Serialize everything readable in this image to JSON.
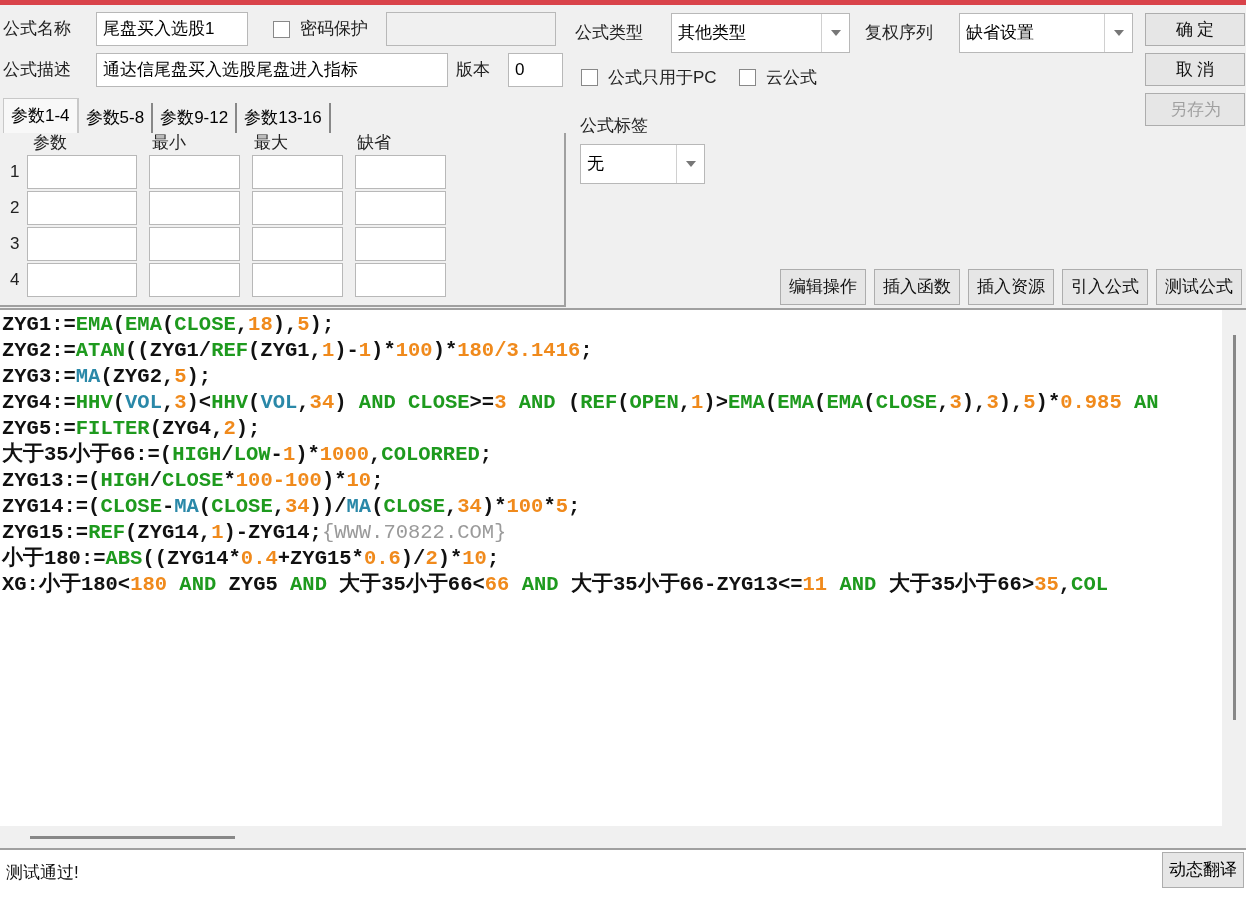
{
  "form": {
    "name_label": "公式名称",
    "name_value": "尾盘买入选股1",
    "password": {
      "label": "密码保护",
      "checked": false
    },
    "desc_label": "公式描述",
    "desc_value": "通达信尾盘买入选股尾盘进入指标",
    "version_label": "版本",
    "version_value": "0",
    "type_label": "公式类型",
    "type_value": "其他类型",
    "rights_label": "复权序列",
    "rights_value": "缺省设置",
    "options": [
      {
        "label": "公式只用于PC",
        "checked": false
      },
      {
        "label": "云公式",
        "checked": false
      }
    ],
    "tag_label": "公式标签",
    "tag_value": "无"
  },
  "dialog_buttons": [
    {
      "label": "确 定",
      "disabled": false
    },
    {
      "label": "取 消",
      "disabled": false
    },
    {
      "label": "另存为",
      "disabled": true
    }
  ],
  "param_tabs": [
    {
      "label": "参数1-4",
      "selected": true
    },
    {
      "label": "参数5-8",
      "selected": false
    },
    {
      "label": "参数9-12",
      "selected": false
    },
    {
      "label": "参数13-16",
      "selected": false
    }
  ],
  "param_columns": [
    "参数",
    "最小",
    "最大",
    "缺省"
  ],
  "param_rows": [
    "1",
    "2",
    "3",
    "4"
  ],
  "tool_buttons": [
    "编辑操作",
    "插入函数",
    "插入资源",
    "引入公式",
    "测试公式"
  ],
  "code_lines": [
    [
      {
        "kind": "text",
        "text": "ZYG1:="
      },
      {
        "kind": "func",
        "text": "EMA"
      },
      {
        "kind": "text",
        "text": "("
      },
      {
        "kind": "func",
        "text": "EMA"
      },
      {
        "kind": "text",
        "text": "("
      },
      {
        "kind": "func",
        "text": "CLOSE"
      },
      {
        "kind": "text",
        "text": ","
      },
      {
        "kind": "num",
        "text": "18"
      },
      {
        "kind": "text",
        "text": "),"
      },
      {
        "kind": "num",
        "text": "5"
      },
      {
        "kind": "text",
        "text": ");"
      }
    ],
    [
      {
        "kind": "text",
        "text": "ZYG2:="
      },
      {
        "kind": "func",
        "text": "ATAN"
      },
      {
        "kind": "text",
        "text": "((ZYG1/"
      },
      {
        "kind": "func",
        "text": "REF"
      },
      {
        "kind": "text",
        "text": "(ZYG1,"
      },
      {
        "kind": "num",
        "text": "1"
      },
      {
        "kind": "text",
        "text": ")-"
      },
      {
        "kind": "num",
        "text": "1"
      },
      {
        "kind": "text",
        "text": ")*"
      },
      {
        "kind": "num",
        "text": "100"
      },
      {
        "kind": "text",
        "text": ")*"
      },
      {
        "kind": "num",
        "text": "180/3.1416"
      },
      {
        "kind": "text",
        "text": ";"
      }
    ],
    [
      {
        "kind": "text",
        "text": "ZYG3:="
      },
      {
        "kind": "var",
        "text": "MA"
      },
      {
        "kind": "text",
        "text": "(ZYG2,"
      },
      {
        "kind": "num",
        "text": "5"
      },
      {
        "kind": "text",
        "text": ");"
      }
    ],
    [
      {
        "kind": "text",
        "text": "ZYG4:="
      },
      {
        "kind": "func",
        "text": "HHV"
      },
      {
        "kind": "text",
        "text": "("
      },
      {
        "kind": "var",
        "text": "VOL"
      },
      {
        "kind": "text",
        "text": ","
      },
      {
        "kind": "num",
        "text": "3"
      },
      {
        "kind": "text",
        "text": ")<"
      },
      {
        "kind": "func",
        "text": "HHV"
      },
      {
        "kind": "text",
        "text": "("
      },
      {
        "kind": "var",
        "text": "VOL"
      },
      {
        "kind": "text",
        "text": ","
      },
      {
        "kind": "num",
        "text": "34"
      },
      {
        "kind": "text",
        "text": ") "
      },
      {
        "kind": "func",
        "text": "AND CLOSE"
      },
      {
        "kind": "text",
        "text": ">="
      },
      {
        "kind": "num",
        "text": "3"
      },
      {
        "kind": "func",
        "text": " AND"
      },
      {
        "kind": "text",
        "text": " ("
      },
      {
        "kind": "func",
        "text": "REF"
      },
      {
        "kind": "text",
        "text": "("
      },
      {
        "kind": "func",
        "text": "OPEN"
      },
      {
        "kind": "text",
        "text": ","
      },
      {
        "kind": "num",
        "text": "1"
      },
      {
        "kind": "text",
        "text": ")>"
      },
      {
        "kind": "func",
        "text": "EMA"
      },
      {
        "kind": "text",
        "text": "("
      },
      {
        "kind": "func",
        "text": "EMA"
      },
      {
        "kind": "text",
        "text": "("
      },
      {
        "kind": "func",
        "text": "EMA"
      },
      {
        "kind": "text",
        "text": "("
      },
      {
        "kind": "func",
        "text": "CLOSE"
      },
      {
        "kind": "text",
        "text": ","
      },
      {
        "kind": "num",
        "text": "3"
      },
      {
        "kind": "text",
        "text": "),"
      },
      {
        "kind": "num",
        "text": "3"
      },
      {
        "kind": "text",
        "text": "),"
      },
      {
        "kind": "num",
        "text": "5"
      },
      {
        "kind": "text",
        "text": ")*"
      },
      {
        "kind": "num",
        "text": "0.985"
      },
      {
        "kind": "func",
        "text": " AN"
      }
    ],
    [
      {
        "kind": "text",
        "text": "ZYG5:="
      },
      {
        "kind": "func",
        "text": "FILTER"
      },
      {
        "kind": "text",
        "text": "(ZYG4,"
      },
      {
        "kind": "num",
        "text": "2"
      },
      {
        "kind": "text",
        "text": ");"
      }
    ],
    [
      {
        "kind": "text",
        "text": "大于35小于66:=("
      },
      {
        "kind": "func",
        "text": "HIGH"
      },
      {
        "kind": "text",
        "text": "/"
      },
      {
        "kind": "func",
        "text": "LOW"
      },
      {
        "kind": "text",
        "text": "-"
      },
      {
        "kind": "num",
        "text": "1"
      },
      {
        "kind": "text",
        "text": ")*"
      },
      {
        "kind": "num",
        "text": "1000"
      },
      {
        "kind": "text",
        "text": ","
      },
      {
        "kind": "func",
        "text": "COLORRED"
      },
      {
        "kind": "text",
        "text": ";"
      }
    ],
    [
      {
        "kind": "text",
        "text": "ZYG13:=("
      },
      {
        "kind": "func",
        "text": "HIGH"
      },
      {
        "kind": "text",
        "text": "/"
      },
      {
        "kind": "func",
        "text": "CLOSE"
      },
      {
        "kind": "text",
        "text": "*"
      },
      {
        "kind": "num",
        "text": "100-100"
      },
      {
        "kind": "text",
        "text": ")*"
      },
      {
        "kind": "num",
        "text": "10"
      },
      {
        "kind": "text",
        "text": ";"
      }
    ],
    [
      {
        "kind": "text",
        "text": "ZYG14:=("
      },
      {
        "kind": "func",
        "text": "CLOSE"
      },
      {
        "kind": "text",
        "text": "-"
      },
      {
        "kind": "var",
        "text": "MA"
      },
      {
        "kind": "text",
        "text": "("
      },
      {
        "kind": "func",
        "text": "CLOSE"
      },
      {
        "kind": "text",
        "text": ","
      },
      {
        "kind": "num",
        "text": "34"
      },
      {
        "kind": "text",
        "text": "))/"
      },
      {
        "kind": "var",
        "text": "MA"
      },
      {
        "kind": "text",
        "text": "("
      },
      {
        "kind": "func",
        "text": "CLOSE"
      },
      {
        "kind": "text",
        "text": ","
      },
      {
        "kind": "num",
        "text": "34"
      },
      {
        "kind": "text",
        "text": ")*"
      },
      {
        "kind": "num",
        "text": "100"
      },
      {
        "kind": "text",
        "text": "*"
      },
      {
        "kind": "num",
        "text": "5"
      },
      {
        "kind": "text",
        "text": ";"
      }
    ],
    [
      {
        "kind": "text",
        "text": "ZYG15:="
      },
      {
        "kind": "func",
        "text": "REF"
      },
      {
        "kind": "text",
        "text": "(ZYG14,"
      },
      {
        "kind": "num",
        "text": "1"
      },
      {
        "kind": "text",
        "text": ")-ZYG14;"
      },
      {
        "kind": "comment",
        "text": "{WWW.70822.COM}"
      }
    ],
    [
      {
        "kind": "text",
        "text": "小于180:="
      },
      {
        "kind": "func",
        "text": "ABS"
      },
      {
        "kind": "text",
        "text": "((ZYG14*"
      },
      {
        "kind": "num",
        "text": "0.4"
      },
      {
        "kind": "text",
        "text": "+ZYG15*"
      },
      {
        "kind": "num",
        "text": "0.6"
      },
      {
        "kind": "text",
        "text": ")/"
      },
      {
        "kind": "num",
        "text": "2"
      },
      {
        "kind": "text",
        "text": ")*"
      },
      {
        "kind": "num",
        "text": "10"
      },
      {
        "kind": "text",
        "text": ";"
      }
    ],
    [
      {
        "kind": "text",
        "text": "XG:小于180<"
      },
      {
        "kind": "num",
        "text": "180"
      },
      {
        "kind": "func",
        "text": " AND"
      },
      {
        "kind": "text",
        "text": " ZYG5 "
      },
      {
        "kind": "func",
        "text": "AND"
      },
      {
        "kind": "text",
        "text": " 大于35小于66<"
      },
      {
        "kind": "num",
        "text": "66"
      },
      {
        "kind": "func",
        "text": " AND"
      },
      {
        "kind": "text",
        "text": " 大于35小于66-ZYG13<="
      },
      {
        "kind": "num",
        "text": "11"
      },
      {
        "kind": "func",
        "text": " AND"
      },
      {
        "kind": "text",
        "text": " 大于35小于66>"
      },
      {
        "kind": "num",
        "text": "35"
      },
      {
        "kind": "text",
        "text": ","
      },
      {
        "kind": "func",
        "text": "COL"
      }
    ]
  ],
  "status": "测试通过!",
  "translate_button": "动态翻译"
}
